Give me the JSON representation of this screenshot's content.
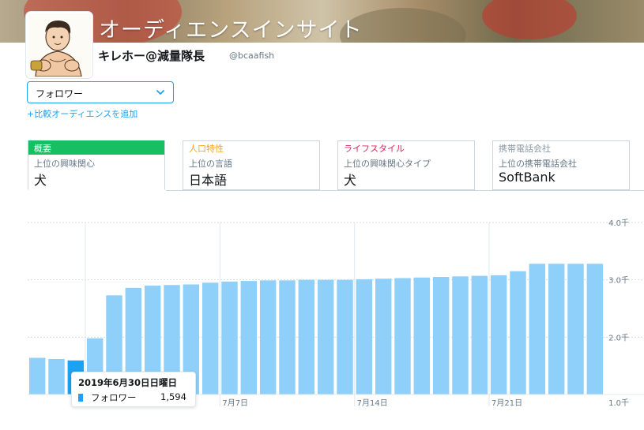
{
  "banner": {
    "title": "オーディエンスインサイト"
  },
  "account": {
    "name": "キレホー@減量隊長",
    "handle": "@bcaafish"
  },
  "audience_select": {
    "value": "フォロワー"
  },
  "add_comparison": "+比較オーディエンスを追加",
  "tabs": [
    {
      "header": "概要",
      "subtitle": "上位の興味関心",
      "value": "犬",
      "header_color": "#ffffff",
      "active": true
    },
    {
      "header": "人口特性",
      "subtitle": "上位の言語",
      "value": "日本語",
      "header_color": "#f5a623",
      "active": false
    },
    {
      "header": "ライフスタイル",
      "subtitle": "上位の興味関心タイプ",
      "value": "犬",
      "header_color": "#e0245e",
      "active": false
    },
    {
      "header": "携帯電話会社",
      "subtitle": "上位の携帯電話会社",
      "value": "SoftBank",
      "header_color": "#8899a6",
      "active": false
    }
  ],
  "chart_data": {
    "type": "bar",
    "series": [
      {
        "name": "フォロワー",
        "values": [
          1640,
          1620,
          1594,
          1980,
          2730,
          2860,
          2900,
          2910,
          2920,
          2950,
          2970,
          2980,
          2990,
          2990,
          3000,
          3000,
          3000,
          3010,
          3020,
          3030,
          3040,
          3050,
          3060,
          3070,
          3080,
          3150,
          3280,
          3280,
          3280,
          3280
        ]
      }
    ],
    "highlight_index": 2,
    "yticks": [
      "4.0千",
      "3.0千",
      "2.0千",
      "1.0千"
    ],
    "ylim": [
      1000,
      4000
    ],
    "xtick_labels": [
      "7月7日",
      "7月14日",
      "7月21日"
    ],
    "grid": true,
    "bar_color": "#8ed0f9",
    "highlight_color": "#1da1f2"
  },
  "tooltip": {
    "date": "2019年6月30日日曜日",
    "series_name": "フォロワー",
    "value": "1,594"
  }
}
